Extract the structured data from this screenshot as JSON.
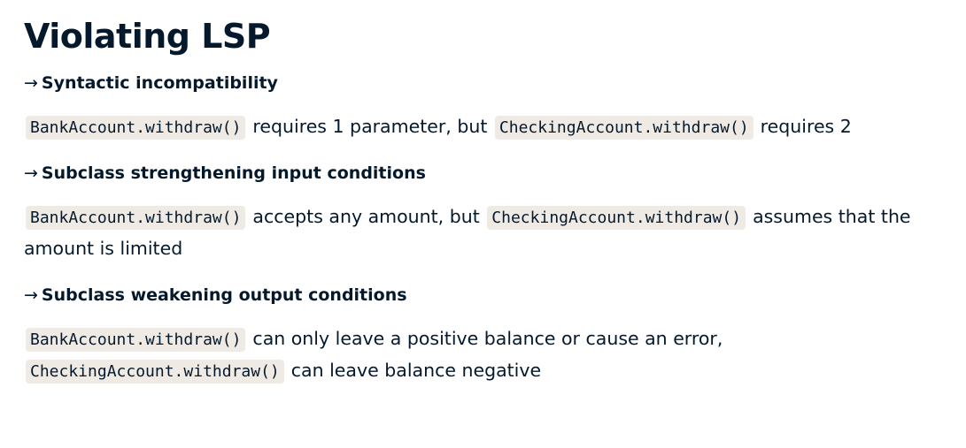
{
  "title": "Violating LSP",
  "arrow": "→",
  "sections": [
    {
      "heading": "Syntactic incompatibility",
      "code_a": "BankAccount.withdraw()",
      "text_a": "requires 1 parameter, but",
      "code_b": "CheckingAccount.withdraw()",
      "text_b": "requires 2"
    },
    {
      "heading": "Subclass strengthening input conditions",
      "code_a": "BankAccount.withdraw()",
      "text_a": "accepts any amount, but",
      "code_b": "CheckingAccount.withdraw()",
      "text_b": "assumes that the amount is limited"
    },
    {
      "heading": "Subclass weakening output conditions",
      "code_a": "BankAccount.withdraw()",
      "text_a": "can only leave a positive balance or cause an error,",
      "code_b": "CheckingAccount.withdraw()",
      "text_b": "can leave balance negative"
    }
  ]
}
